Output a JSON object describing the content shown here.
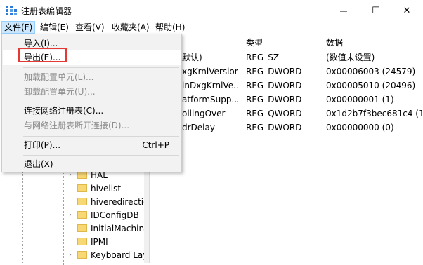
{
  "window": {
    "title": "注册表编辑器",
    "controls": {
      "minimize": "—",
      "maximize": "☐",
      "close": "✕"
    }
  },
  "menubar": [
    {
      "label": "文件(F)"
    },
    {
      "label": "编辑(E)"
    },
    {
      "label": "查看(V)"
    },
    {
      "label": "收藏夹(A)"
    },
    {
      "label": "帮助(H)"
    }
  ],
  "file_menu": {
    "items": [
      {
        "label": "导入(I)...",
        "shortcut": "",
        "disabled": false
      },
      {
        "label": "导出(E)...",
        "shortcut": "",
        "disabled": false
      },
      {
        "label": "加载配置单元(L)...",
        "shortcut": "",
        "disabled": true
      },
      {
        "label": "卸载配置单元(U)...",
        "shortcut": "",
        "disabled": true
      },
      {
        "label": "连接网络注册表(C)...",
        "shortcut": "",
        "disabled": false
      },
      {
        "label": "与网络注册表断开连接(D)...",
        "shortcut": "",
        "disabled": true
      },
      {
        "label": "打印(P)...",
        "shortcut": "Ctrl+P",
        "disabled": false
      },
      {
        "label": "退出(X)",
        "shortcut": "",
        "disabled": false
      }
    ]
  },
  "tree": [
    {
      "label": "HAL",
      "expandable": true
    },
    {
      "label": "hivelist",
      "expandable": false
    },
    {
      "label": "hiveredirectio",
      "expandable": false
    },
    {
      "label": "IDConfigDB",
      "expandable": true
    },
    {
      "label": "InitialMachine",
      "expandable": false
    },
    {
      "label": "IPMI",
      "expandable": false
    },
    {
      "label": "Keyboard Lay",
      "expandable": true
    }
  ],
  "list": {
    "headers": {
      "type": "类型",
      "data": "数据"
    },
    "rows": [
      {
        "name": "默认)",
        "type": "REG_SZ",
        "data": "(数值未设置)"
      },
      {
        "name": "xgKrnlVersion",
        "type": "REG_DWORD",
        "data": "0x00006003 (24579)"
      },
      {
        "name": "inDxgKrnlVe...",
        "type": "REG_DWORD",
        "data": "0x00005010 (20496)"
      },
      {
        "name": "atformSupp...",
        "type": "REG_DWORD",
        "data": "0x00000001 (1)"
      },
      {
        "name": "ollingOver",
        "type": "REG_QWORD",
        "data": "0x1d2b7f3bec681c4 (131"
      },
      {
        "name": "drDelay",
        "type": "REG_DWORD",
        "data": "0x00000000 (0)"
      }
    ]
  }
}
